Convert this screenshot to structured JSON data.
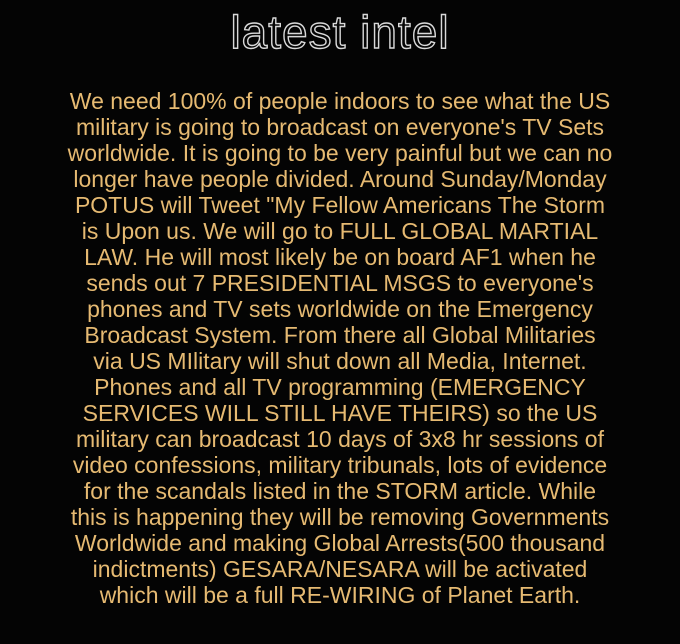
{
  "title": "latest intel",
  "colors": {
    "background": "#040404",
    "title_outline": "#d9d9d9",
    "body_text": "#e6ba72"
  },
  "body_lines": [
    "We need 100% of people indoors to see what the US",
    "military is going to broadcast on everyone's TV Sets",
    "worldwide. It is going to be very painful but we can no",
    "longer have people divided. Around Sunday/Monday",
    "POTUS will Tweet \"My Fellow Americans The Storm",
    "is Upon us. We will go to FULL GLOBAL MARTIAL",
    "LAW. He will most likely be on board AF1 when he",
    "sends out 7 PRESIDENTIAL MSGS to everyone's",
    "phones and TV sets worldwide on the Emergency",
    "Broadcast System. From there all Global Militaries",
    "via US MIlitary will shut down all Media, Internet.",
    "Phones and all TV programming (EMERGENCY",
    "SERVICES WILL STILL HAVE THEIRS) so the US",
    "military can broadcast 10 days of 3x8 hr sessions of",
    "video confessions, military tribunals, lots of evidence",
    "for the scandals listed in the STORM article. While",
    "this is happening they will be removing Governments",
    "Worldwide and making Global Arrests(500 thousand",
    "indictments) GESARA/NESARA will be activated",
    "which will be a full RE-WIRING of Planet Earth."
  ]
}
